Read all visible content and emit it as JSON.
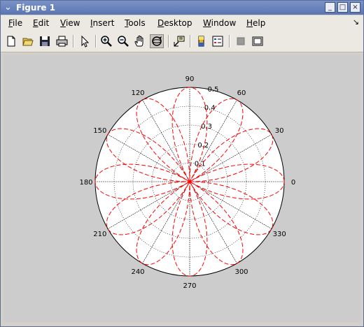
{
  "window": {
    "title": "Figure 1",
    "buttons": {
      "minimize": "_",
      "maximize": "□",
      "close": "×"
    }
  },
  "menubar": {
    "items": [
      "File",
      "Edit",
      "View",
      "Insert",
      "Tools",
      "Desktop",
      "Window",
      "Help"
    ],
    "dock_arrow": "↘"
  },
  "toolbar": {
    "tools": [
      "new-figure",
      "open-file",
      "save-figure",
      "print-figure",
      "edit-plot",
      "zoom-in",
      "zoom-out",
      "pan",
      "rotate-3d",
      "data-cursor",
      "insert-colorbar",
      "insert-legend",
      "hide-plot-tools",
      "show-plot-tools"
    ],
    "active_tool": "rotate-3d"
  },
  "chart_data": {
    "type": "polar",
    "angle_labels": [
      "0",
      "30",
      "60",
      "90",
      "120",
      "150",
      "180",
      "210",
      "240",
      "270",
      "300",
      "330"
    ],
    "radial_labels": [
      "0.1",
      "0.2",
      "0.3",
      "0.4",
      "0.5"
    ],
    "rlim": [
      0,
      0.5
    ],
    "grid": true,
    "series": [
      {
        "function": "r = 0.5·|sin(3θ)|",
        "color": "#ff0000",
        "line_style": "dashed"
      },
      {
        "function": "r = 0.5·|cos(3θ)|",
        "color": "#ff0000",
        "line_style": "dashed"
      }
    ]
  }
}
